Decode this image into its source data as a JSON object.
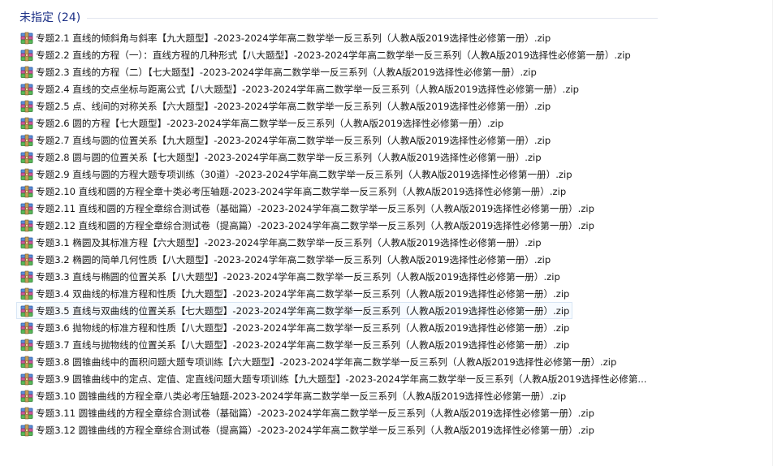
{
  "group": {
    "title": "未指定 (24)"
  },
  "icon": "winrar-archive-icon",
  "selected_index": 16,
  "files": [
    "专题2.1 直线的倾斜角与斜率【九大题型】-2023-2024学年高二数学举一反三系列（人教A版2019选择性必修第一册）.zip",
    "专题2.2 直线的方程（一）：直线方程的几种形式【八大题型】-2023-2024学年高二数学举一反三系列（人教A版2019选择性必修第一册）.zip",
    "专题2.3 直线的方程（二）【七大题型】-2023-2024学年高二数学举一反三系列（人教A版2019选择性必修第一册）.zip",
    "专题2.4 直线的交点坐标与距离公式【八大题型】-2023-2024学年高二数学举一反三系列（人教A版2019选择性必修第一册）.zip",
    "专题2.5 点、线间的对称关系【六大题型】-2023-2024学年高二数学举一反三系列（人教A版2019选择性必修第一册）.zip",
    "专题2.6 圆的方程【七大题型】-2023-2024学年高二数学举一反三系列（人教A版2019选择性必修第一册）.zip",
    "专题2.7 直线与圆的位置关系【九大题型】-2023-2024学年高二数学举一反三系列（人教A版2019选择性必修第一册）.zip",
    "专题2.8 圆与圆的位置关系【七大题型】-2023-2024学年高二数学举一反三系列（人教A版2019选择性必修第一册）.zip",
    "专题2.9 直线与圆的方程大题专项训练（30道）-2023-2024学年高二数学举一反三系列（人教A版2019选择性必修第一册）.zip",
    "专题2.10 直线和圆的方程全章十类必考压轴题-2023-2024学年高二数学举一反三系列（人教A版2019选择性必修第一册）.zip",
    "专题2.11 直线和圆的方程全章综合测试卷（基础篇）-2023-2024学年高二数学举一反三系列（人教A版2019选择性必修第一册）.zip",
    "专题2.12 直线和圆的方程全章综合测试卷（提高篇）-2023-2024学年高二数学举一反三系列（人教A版2019选择性必修第一册）.zip",
    "专题3.1 椭圆及其标准方程【六大题型】-2023-2024学年高二数学举一反三系列（人教A版2019选择性必修第一册）.zip",
    "专题3.2 椭圆的简单几何性质【八大题型】-2023-2024学年高二数学举一反三系列（人教A版2019选择性必修第一册）.zip",
    "专题3.3 直线与椭圆的位置关系【八大题型】-2023-2024学年高二数学举一反三系列（人教A版2019选择性必修第一册）.zip",
    "专题3.4 双曲线的标准方程和性质【九大题型】-2023-2024学年高二数学举一反三系列（人教A版2019选择性必修第一册）.zip",
    "专题3.5 直线与双曲线的位置关系【七大题型】-2023-2024学年高二数学举一反三系列（人教A版2019选择性必修第一册）.zip",
    "专题3.6 抛物线的标准方程和性质【八大题型】-2023-2024学年高二数学举一反三系列（人教A版2019选择性必修第一册）.zip",
    "专题3.7 直线与抛物线的位置关系【八大题型】-2023-2024学年高二数学举一反三系列（人教A版2019选择性必修第一册）.zip",
    "专题3.8 圆锥曲线中的面积问题大题专项训练【六大题型】-2023-2024学年高二数学举一反三系列（人教A版2019选择性必修第一册）.zip",
    "专题3.9 圆锥曲线中的定点、定值、定直线问题大题专项训练【九大题型】-2023-2024学年高二数学举一反三系列（人教A版2019选择性必修第...",
    "专题3.10 圆锥曲线的方程全章八类必考压轴题-2023-2024学年高二数学举一反三系列（人教A版2019选择性必修第一册）.zip",
    "专题3.11 圆锥曲线的方程全章综合测试卷（基础篇）-2023-2024学年高二数学举一反三系列（人教A版2019选择性必修第一册）.zip",
    "专题3.12 圆锥曲线的方程全章综合测试卷（提高篇）-2023-2024学年高二数学举一反三系列（人教A版2019选择性必修第一册）.zip"
  ]
}
